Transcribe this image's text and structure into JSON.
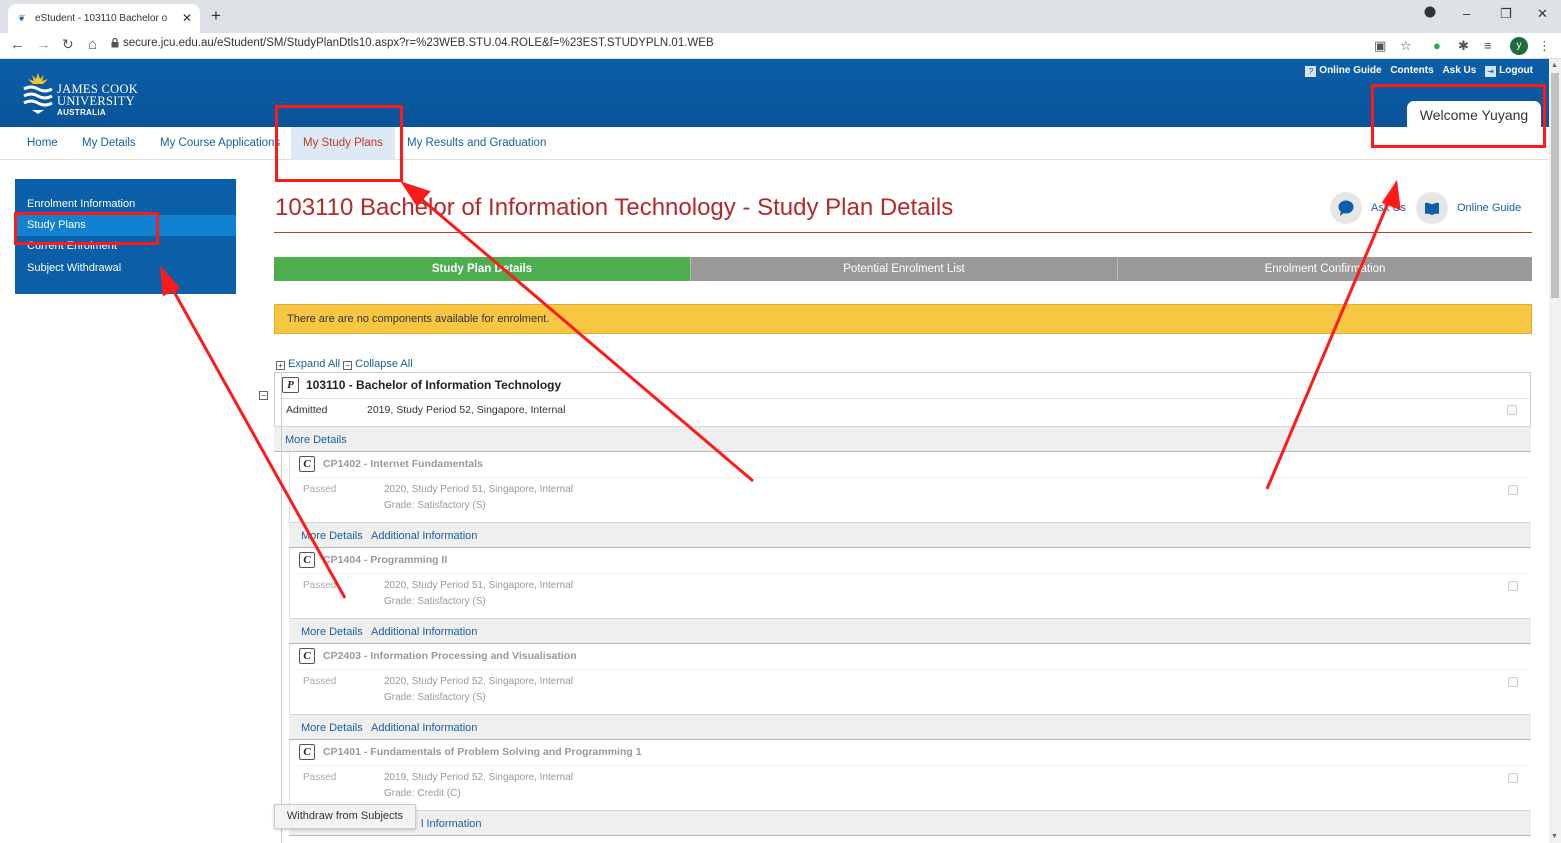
{
  "browser": {
    "tab_title": "eStudent - 103110 Bachelor o",
    "new_tab": "+",
    "url": "secure.jcu.edu.au/eStudent/SM/StudyPlanDtls10.aspx?r=%23WEB.STU.04.ROLE&f=%23EST.STUDYPLN.01.WEB",
    "profile_initial": "y"
  },
  "header": {
    "logo_line1": "JAMES COOK",
    "logo_line2": "UNIVERSITY",
    "logo_line3": "AUSTRALIA",
    "links": [
      "Online Guide",
      "Contents",
      "Ask Us",
      "Logout"
    ],
    "help_icon": "?",
    "welcome": "Welcome Yuyang"
  },
  "menu": {
    "items": [
      "Home",
      "My Details",
      "My Course Applications",
      "My Study Plans",
      "My Results and Graduation"
    ],
    "active": "My Study Plans"
  },
  "sidebar": {
    "items": [
      "Enrolment Information",
      "Study Plans",
      "Current Enrolment",
      "Subject Withdrawal"
    ],
    "selected": "Study Plans"
  },
  "page": {
    "title": "103110 Bachelor of Information Technology - Study Plan Details",
    "ask_us": "Ask Us",
    "online_guide": "Online Guide"
  },
  "steps": [
    "Study Plan Details",
    "Potential Enrolment List",
    "Enrolment Confirmation"
  ],
  "alert": "There are are no components available for enrolment.",
  "tree": {
    "expand_all": "Expand All",
    "collapse_all": "Collapse All",
    "expand_glyph": "+",
    "collapse_glyph": "−"
  },
  "program": {
    "badge": "P",
    "title": "103110 - Bachelor of Information Technology",
    "status": "Admitted",
    "detail": "2019, Study Period 52, Singapore, Internal",
    "more_details": "More Details"
  },
  "subjects": [
    {
      "badge": "C",
      "title": "CP1402 - Internet Fundamentals",
      "status": "Passed",
      "detail": "2020, Study Period 51, Singapore, Internal",
      "grade": "Grade: Satisfactory (S)"
    },
    {
      "badge": "C",
      "title": "CP1404 - Programming II",
      "status": "Passed",
      "detail": "2020, Study Period 51, Singapore, Internal",
      "grade": "Grade: Satisfactory (S)"
    },
    {
      "badge": "C",
      "title": "CP2403 - Information Processing and Visualisation",
      "status": "Passed",
      "detail": "2020, Study Period 52, Singapore, Internal",
      "grade": "Grade: Satisfactory (S)"
    },
    {
      "badge": "C",
      "title": "CP1401 - Fundamentals of Problem Solving and Programming 1",
      "status": "Passed",
      "detail": "2019, Study Period 52, Singapore, Internal",
      "grade": "Grade: Credit (C)"
    }
  ],
  "links": {
    "more_details": "More Details",
    "additional_information": "Additional Information",
    "additional_information_partial": "l Information"
  },
  "withdraw_button": "Withdraw from Subjects",
  "colors": {
    "header_blue": "#0b5ea8",
    "title_red": "#b22a2a",
    "step_active": "#4cae4c",
    "step_inactive": "#999999",
    "alert_yellow": "#f7c744",
    "annotation_red": "#ff1a1a"
  }
}
